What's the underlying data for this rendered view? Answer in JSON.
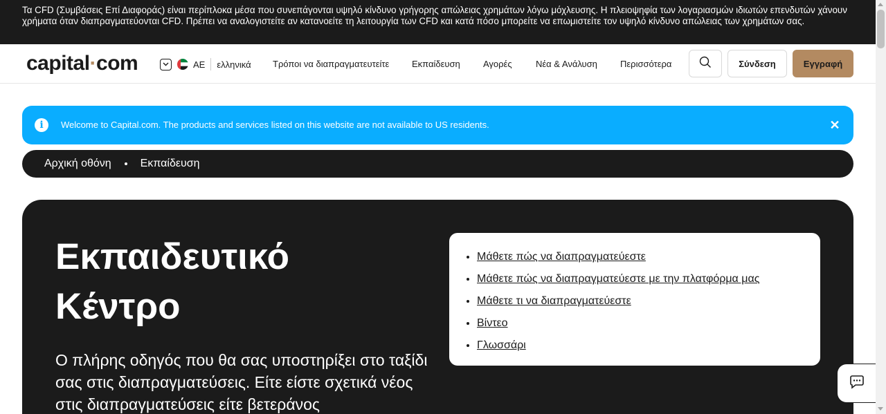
{
  "risk_banner": {
    "text": "Τα CFD (Συμβάσεις Επί Διαφοράς) είναι περίπλοκα μέσα που συνεπάγονται υψηλό κίνδυνο γρήγορης απώλειας χρημάτων λόγω μόχλευσης. Η πλειοψηφία των λογαριασμών ιδιωτών επενδυτών χάνουν χρήματα όταν διαπραγματεύονται CFD. Πρέπει να αναλογιστείτε αν κατανοείτε τη λειτουργία των CFD και κατά πόσο μπορείτε να επωμιστείτε τον υψηλό κίνδυνο απώλειας των χρημάτων σας."
  },
  "header": {
    "logo_left": "capital",
    "logo_dot": "·",
    "logo_right": "com",
    "region": "AE",
    "language": "ελληνικά",
    "nav": [
      "Τρόποι να διαπραγματευτείτε",
      "Εκπαίδευση",
      "Αγορές",
      "Νέα & Ανάλυση",
      "Περισσότερα"
    ],
    "login_label": "Σύνδεση",
    "signup_label": "Εγγραφή"
  },
  "notice": {
    "message": "Welcome to Capital.com. The products and services listed on this website are not available to US residents.",
    "close_glyph": "✕"
  },
  "breadcrumb": {
    "home": "Αρχική οθόνη",
    "current": "Εκπαίδευση"
  },
  "hero": {
    "title_line1": "Εκπαιδευτικό",
    "title_line2": "Κέντρο",
    "lead": "Ο πλήρης οδηγός που θα σας υποστηρίξει στο ταξίδι σας στις διαπραγματεύσεις. Είτε είστε σχετικά νέος στις διαπραγματεύσεις είτε βετεράνος",
    "links": [
      "Μάθετε πώς να διαπραγματεύεστε",
      "Μάθετε πώς να διαπραγματεύεστε με την πλατφόρμα μας",
      "Μάθετε τι να διαπραγματεύεστε",
      "Βίντεο",
      "Γλωσσάρι"
    ]
  },
  "colors": {
    "brand_accent": "#b38a61",
    "notice_blue": "#0aadff",
    "dark": "#1b1b1b"
  },
  "icons": {
    "search": "search-icon",
    "info": "info-icon",
    "close": "close-icon",
    "chat": "chat-icon",
    "chevron": "chevron-down-icon",
    "flag": "uae-flag-icon"
  }
}
